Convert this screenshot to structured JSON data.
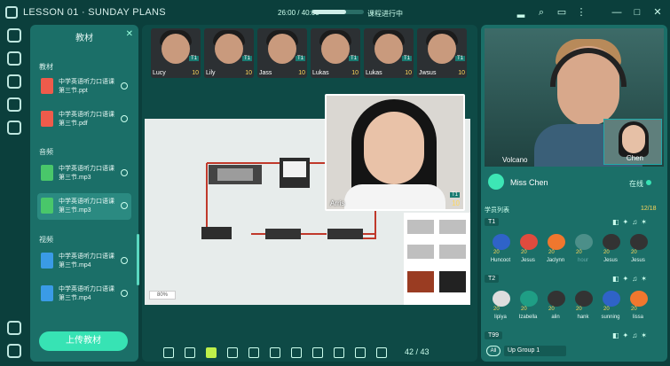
{
  "app": {
    "title": "LESSON 01 · SUNDAY PLANS",
    "timer": "26:00 / 40:00",
    "status": "课程进行中",
    "progress": 0.65
  },
  "left_panel": {
    "title": "教材",
    "sections": [
      {
        "name": "教材",
        "files": [
          {
            "name": "中学英语听力口语课第三节.ppt",
            "type": "ppt"
          },
          {
            "name": "中学英语听力口语课第三节.pdf",
            "type": "pdf"
          }
        ]
      },
      {
        "name": "音频",
        "files": [
          {
            "name": "中学英语听力口语课第三节.mp3",
            "type": "mp3"
          },
          {
            "name": "中学英语听力口语课第三节.mp3",
            "type": "mp3",
            "active": true
          }
        ]
      },
      {
        "name": "视频",
        "files": [
          {
            "name": "中学英语听力口语课第三节.mp4",
            "type": "mp4"
          },
          {
            "name": "中学英语听力口语课第三节.mp4",
            "type": "mp4"
          }
        ]
      }
    ],
    "upload_label": "上传教材"
  },
  "thumbnails": [
    {
      "name": "Lucy",
      "score": "10",
      "tag": "T1"
    },
    {
      "name": "Lily",
      "score": "10",
      "tag": "T1"
    },
    {
      "name": "Jass",
      "score": "10",
      "tag": "T1"
    },
    {
      "name": "Lukas",
      "score": "10",
      "tag": "T1"
    },
    {
      "name": "Lukas",
      "score": "10",
      "tag": "T1"
    },
    {
      "name": "Jwsus",
      "score": "10",
      "tag": "T1"
    }
  ],
  "spotlight": {
    "name": "Arris",
    "score": "10",
    "tag": "T1"
  },
  "board": {
    "zoom": "80%",
    "page": "42 / 43"
  },
  "teacher": {
    "label": "Volcano",
    "pip_label": "Chen",
    "name": "Miss Chen",
    "status": "在线"
  },
  "roster": {
    "title": "学员列表",
    "count": "12/18",
    "groups": [
      {
        "name": "T1",
        "students": [
          {
            "name": "Huncoot",
            "score": "20"
          },
          {
            "name": "Jesus",
            "score": "20"
          },
          {
            "name": "Jaclynn",
            "score": "20"
          },
          {
            "name": "hour",
            "score": "20"
          },
          {
            "name": "Jesus",
            "score": "20"
          },
          {
            "name": "Jesus",
            "score": "20"
          }
        ]
      },
      {
        "name": "T2",
        "students": [
          {
            "name": "lipiya",
            "score": "20"
          },
          {
            "name": "Izabella",
            "score": "20"
          },
          {
            "name": "alin",
            "score": "20"
          },
          {
            "name": "hank",
            "score": "20"
          },
          {
            "name": "sunning",
            "score": "20"
          },
          {
            "name": "lissa",
            "score": "20"
          }
        ]
      },
      {
        "name": "T99",
        "students": []
      }
    ]
  },
  "footer": {
    "all_label": "All",
    "group_label": "Up Group 1"
  }
}
